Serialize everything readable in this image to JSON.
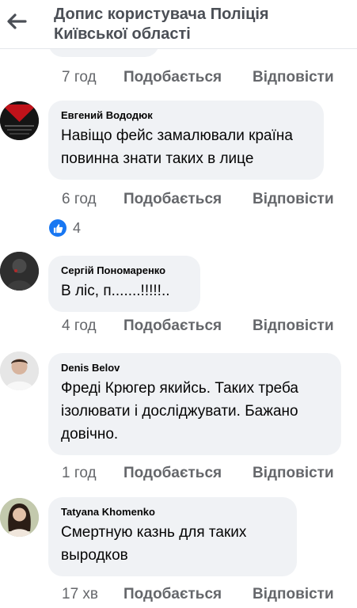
{
  "header": {
    "title": "Допис користувача Поліція Київської області"
  },
  "first_item": {
    "time": "7 год"
  },
  "actions": {
    "like_label": "Подобається",
    "reply_label": "Відповісти"
  },
  "comments": [
    {
      "author": "Евгений Вододюк",
      "text": "Навіщо фейс замалювали країна повинна знати таких в лице",
      "time": "6 год",
      "reaction_count": "4"
    },
    {
      "author": "Сергій Пономаренко",
      "text": "В ліс, п.......!!!!!..",
      "time": "4 год"
    },
    {
      "author": "Denis Belov",
      "text": "Фреді Крюгер якийсь. Таких треба ізолювати і досліджувати. Бажано довічно.",
      "time": "1 год"
    },
    {
      "author": "Tatyana Khomenko",
      "text": "Смертную казнь для таких выродков",
      "time": "17 хв"
    }
  ],
  "colors": {
    "bubble": "#f0f2f5",
    "secondary_text": "#65676b",
    "like_blue": "#1877f2"
  },
  "icons": {
    "back": "arrow-left-icon",
    "reaction": "thumbs-up-icon"
  }
}
